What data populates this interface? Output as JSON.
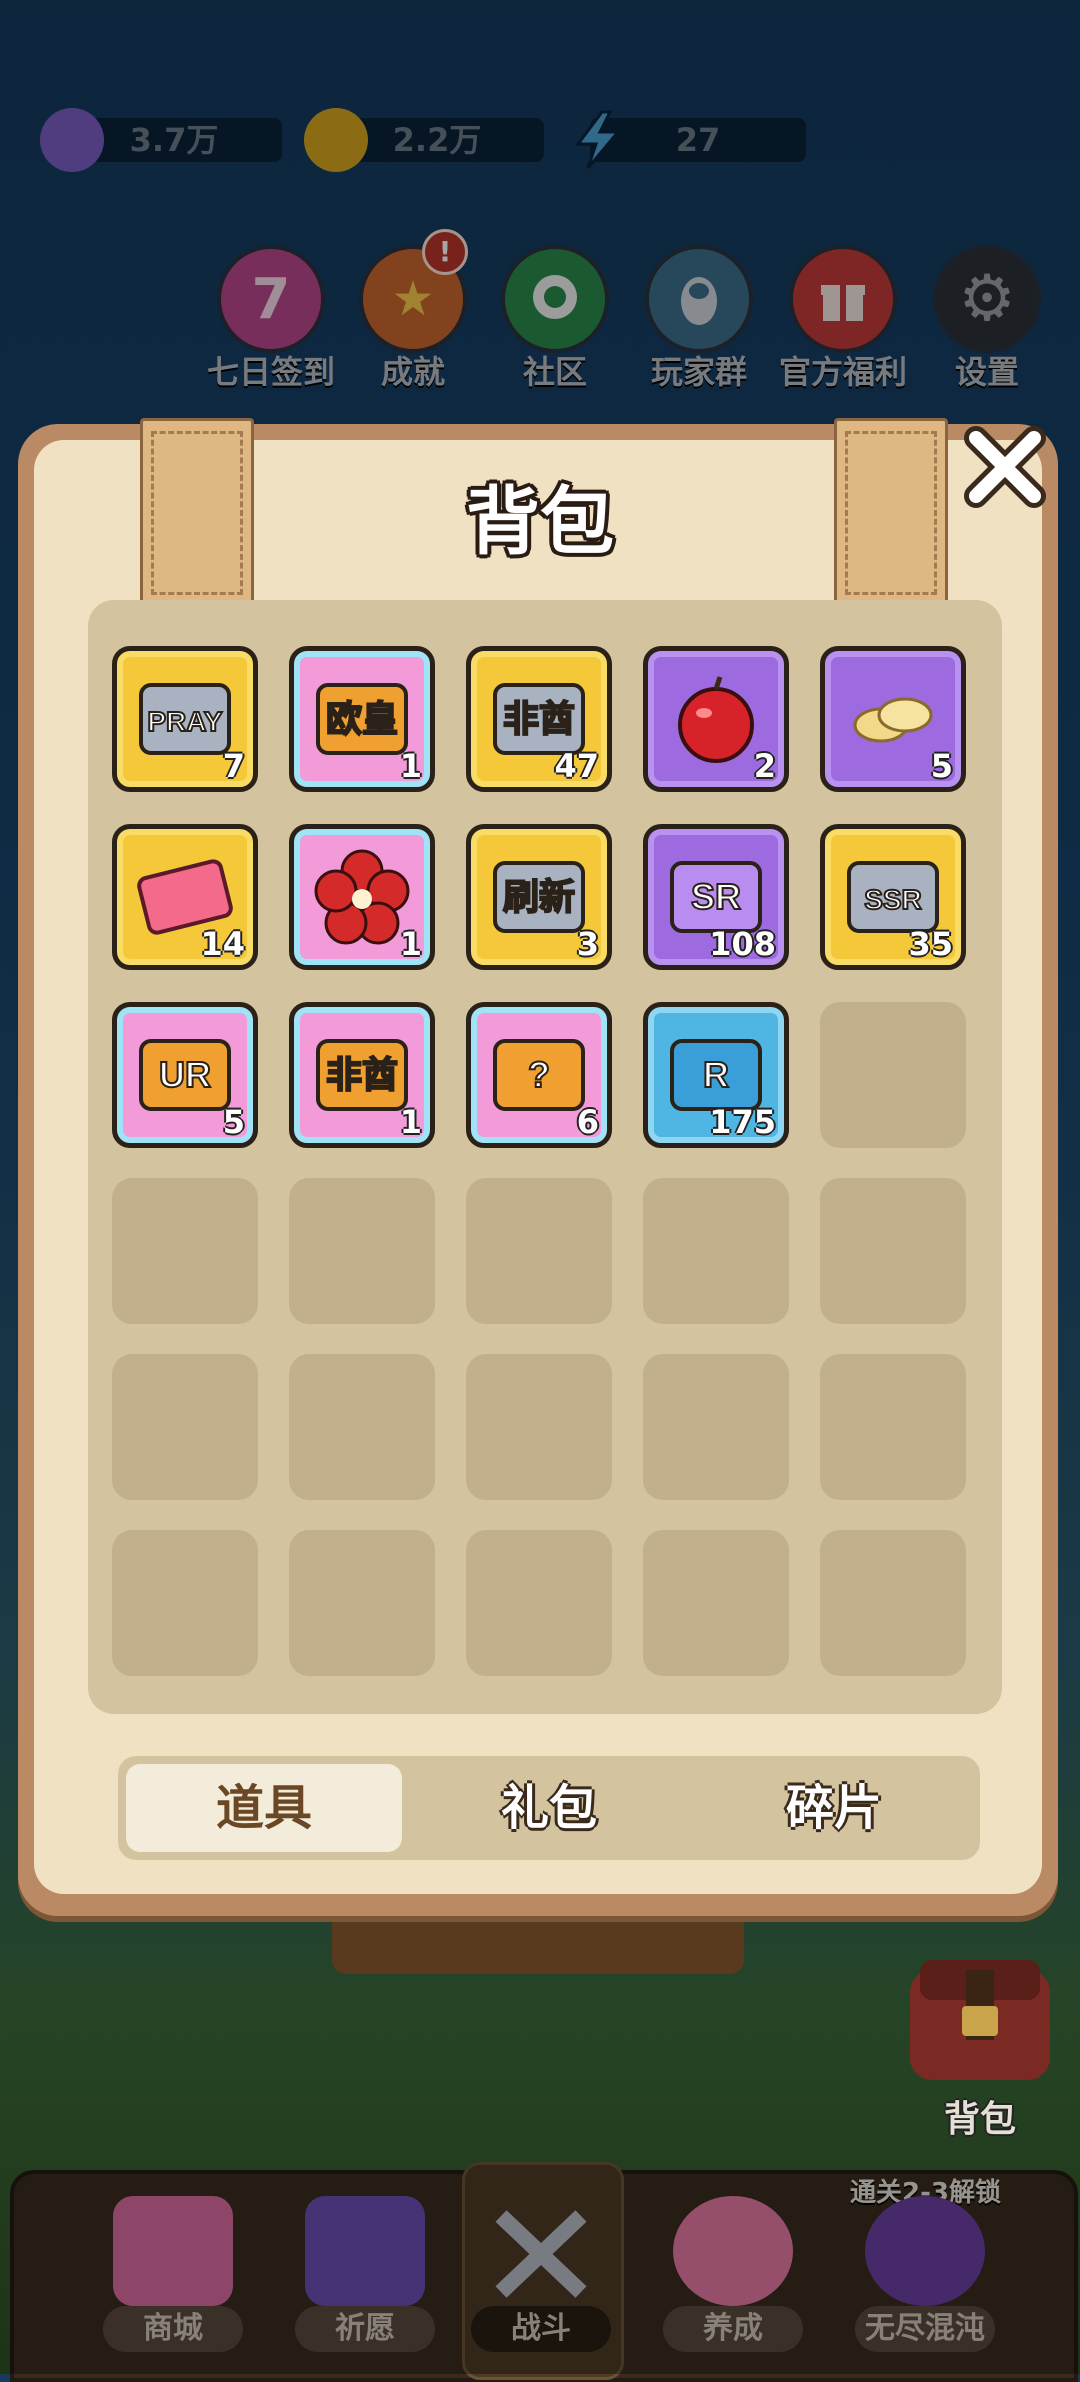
{
  "resources": [
    {
      "icon": "gem-icon",
      "value": "3.7万"
    },
    {
      "icon": "gold-coin-icon",
      "value": "2.2万"
    },
    {
      "icon": "energy-bolt-icon",
      "value": "27"
    }
  ],
  "shortcuts": [
    {
      "icon": "seven-day-icon",
      "glyph": "7",
      "label": "七日签到"
    },
    {
      "icon": "trophy-icon",
      "glyph": "🏆",
      "label": "成就",
      "badge": "!"
    },
    {
      "icon": "community-chat-icon",
      "glyph": "●",
      "label": "社区"
    },
    {
      "icon": "penguin-qq-icon",
      "glyph": "◕",
      "label": "玩家群"
    },
    {
      "icon": "gift-icon",
      "glyph": "🎁",
      "label": "官方福利"
    },
    {
      "icon": "gear-icon",
      "glyph": "⚙",
      "label": "设置"
    }
  ],
  "panel": {
    "title": "背包",
    "items": [
      {
        "name": "pray-ticket-icon",
        "rarity": "gold",
        "art": "PRAY",
        "qty": "7"
      },
      {
        "name": "ouhuang-card-icon",
        "rarity": "pink",
        "art": "欧皇",
        "qty": "1"
      },
      {
        "name": "feiqiu-card-icon",
        "rarity": "gold",
        "art": "非酋",
        "qty": "47"
      },
      {
        "name": "apple-icon",
        "rarity": "purple",
        "art": "",
        "qty": "2"
      },
      {
        "name": "chips-icon",
        "rarity": "purple",
        "art": "",
        "qty": "5"
      },
      {
        "name": "pink-ticket-icon",
        "rarity": "gold",
        "art": "",
        "qty": "14"
      },
      {
        "name": "flower-icon",
        "rarity": "pink",
        "art": "",
        "qty": "1"
      },
      {
        "name": "refresh-card-icon",
        "rarity": "gold",
        "art": "刷新",
        "qty": "3"
      },
      {
        "name": "sr-fragment-icon",
        "rarity": "purple",
        "art": "SR",
        "qty": "108"
      },
      {
        "name": "ssr-fragment-icon",
        "rarity": "gold",
        "art": "SSR",
        "qty": "35"
      },
      {
        "name": "ur-fragment-icon",
        "rarity": "pink",
        "art": "UR",
        "qty": "5"
      },
      {
        "name": "feiqiu-card-icon",
        "rarity": "pink",
        "art": "非酋",
        "qty": "1"
      },
      {
        "name": "mystery-bag-icon",
        "rarity": "pink",
        "art": "?",
        "qty": "6"
      },
      {
        "name": "r-fragment-icon",
        "rarity": "blue",
        "art": "R",
        "qty": "175"
      }
    ],
    "tabs": [
      "道具",
      "礼包",
      "碎片"
    ],
    "active_tab": 0
  },
  "bag_button": {
    "label": "背包"
  },
  "unlock_note": "通关2-3解锁",
  "nav": [
    {
      "icon": "shop-icon",
      "label": "商城",
      "color": "#d96aa0"
    },
    {
      "icon": "pray-cards-icon",
      "label": "祈愿",
      "color": "#6a4fb6"
    },
    {
      "icon": "crossed-swords-icon",
      "label": "战斗",
      "color": "#8a8f9a"
    },
    {
      "icon": "paw-icon",
      "label": "养成",
      "color": "#e77aa5"
    },
    {
      "icon": "lock-icon",
      "label": "无尽混沌",
      "color": "#6b3fa0"
    }
  ]
}
